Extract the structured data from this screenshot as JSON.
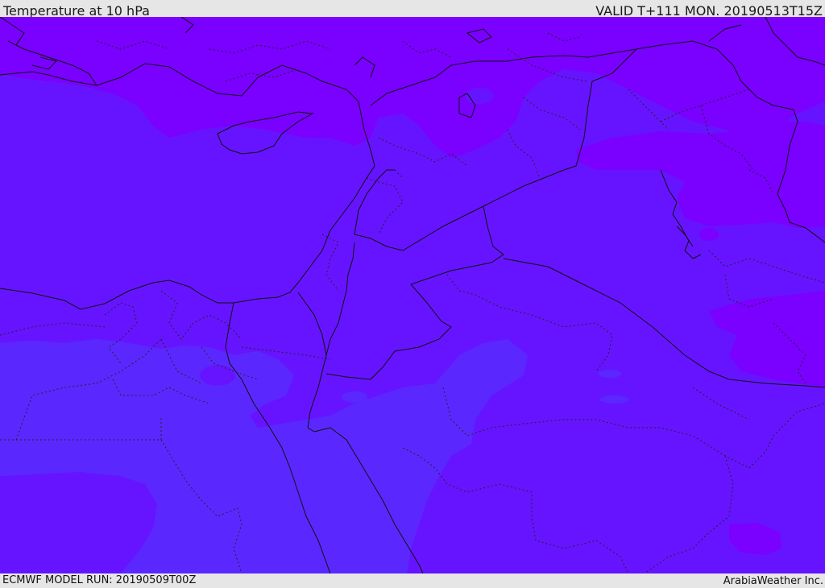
{
  "header": {
    "title": "Temperature at 10 hPa",
    "valid": "VALID T+111 MON. 20190513T15Z"
  },
  "footer": {
    "model_run": "ECMWF MODEL RUN: 20190509T00Z",
    "credit": "ArabiaWeather Inc."
  },
  "colors": {
    "band_violet": "#7a00ff",
    "band_purple": "#6614ff",
    "band_indigo": "#5a28ff",
    "border_line": "#111111",
    "header_bg": "#e6e6e6"
  }
}
